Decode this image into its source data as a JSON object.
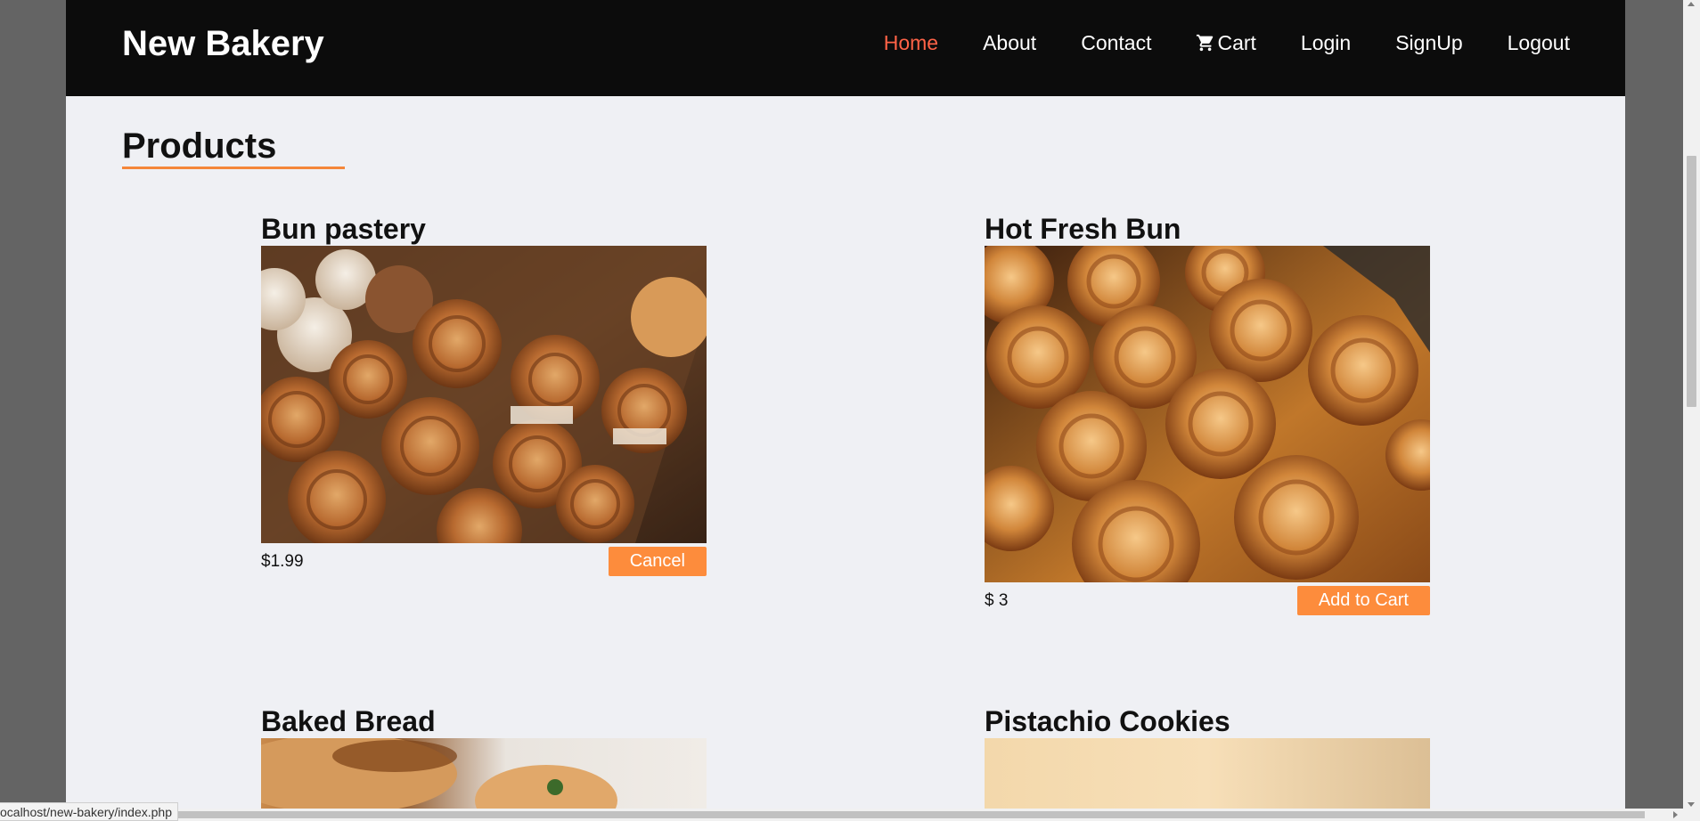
{
  "brand": "New Bakery",
  "nav": {
    "home": "Home",
    "about": "About",
    "contact": "Contact",
    "cart": "Cart",
    "login": "Login",
    "signup": "SignUp",
    "logout": "Logout"
  },
  "section_title": "Products",
  "products": [
    {
      "name": "Bun pastery",
      "price": "$1.99",
      "button": "Cancel"
    },
    {
      "name": "Hot Fresh Bun",
      "price": "$ 3",
      "button": "Add to Cart"
    },
    {
      "name": "Baked Bread"
    },
    {
      "name": "Pistachio Cookies"
    }
  ],
  "status_bar": {
    "url": "ocalhost/new-bakery/index.php"
  },
  "colors": {
    "navbar": "#0c0c0c",
    "active_link": "#ff6347",
    "accent": "#fd8c3c",
    "page_bg": "#eff0f4"
  },
  "icons": {
    "cart": "shopping-cart-icon"
  }
}
